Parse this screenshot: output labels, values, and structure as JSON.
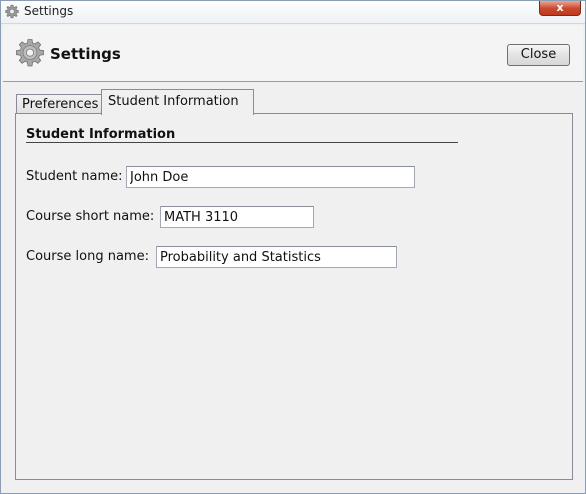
{
  "window": {
    "title": "Settings",
    "close_glyph": "x",
    "icon": "gear-icon"
  },
  "header": {
    "title": "Settings",
    "close_label": "Close",
    "icon": "gear-icon"
  },
  "tabs": [
    {
      "label": "Preferences",
      "selected": false
    },
    {
      "label": "Student Information",
      "selected": true
    }
  ],
  "panel": {
    "section_title": "Student Information",
    "fields": {
      "student_name": {
        "label": "Student name:",
        "value": "John Doe"
      },
      "course_short": {
        "label": "Course short name:",
        "value": "MATH 3110"
      },
      "course_long": {
        "label": "Course long name:",
        "value": "Probability and Statistics"
      }
    }
  },
  "colors": {
    "window_bg": "#f0f0f0",
    "close_red": "#c9462c",
    "border": "#898c95"
  }
}
